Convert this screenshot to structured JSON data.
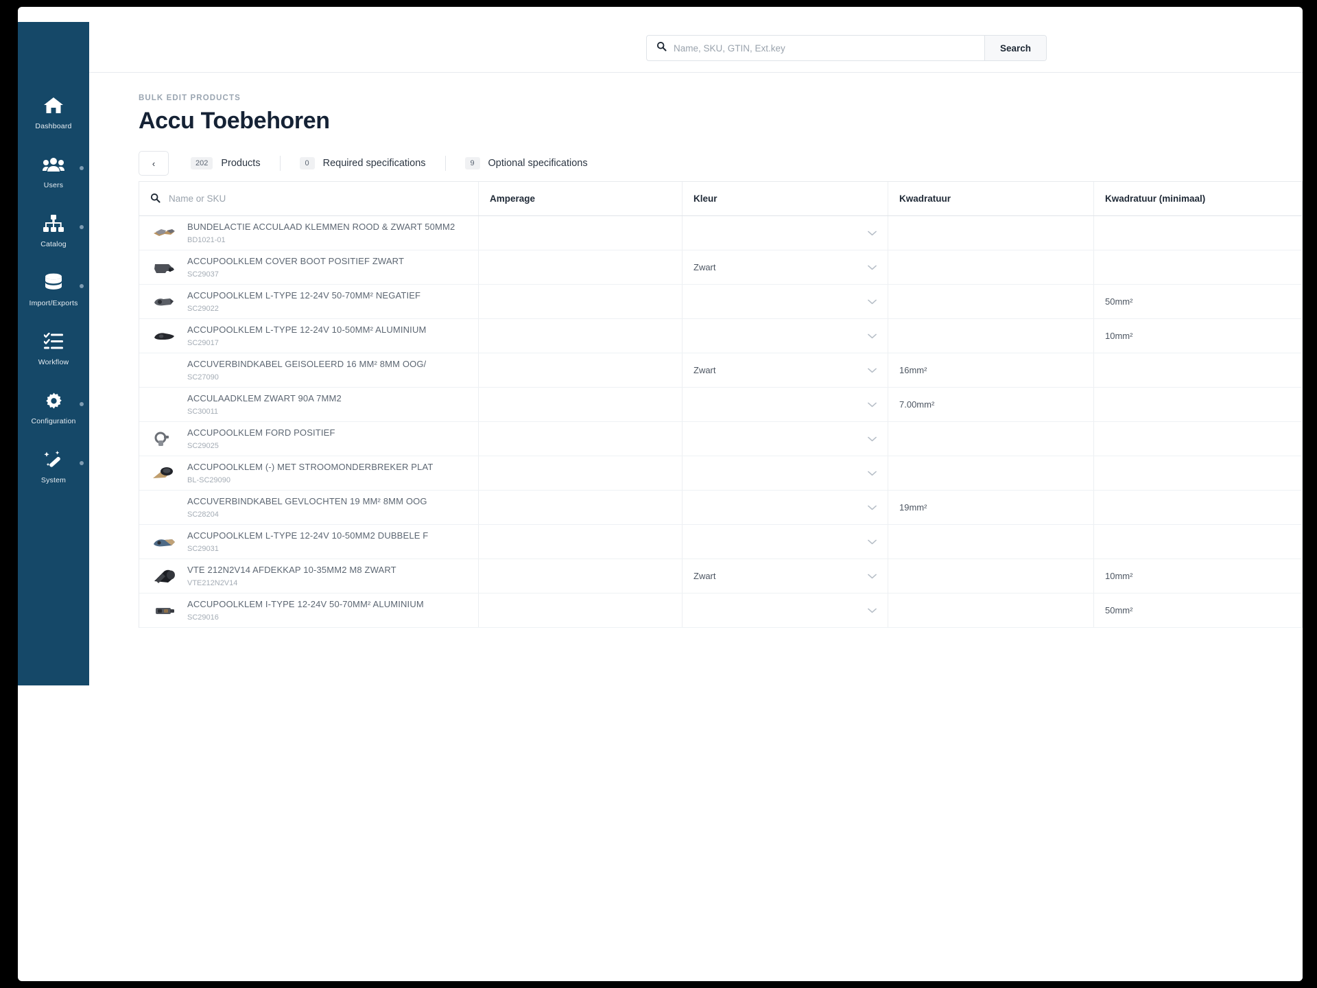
{
  "topbar": {
    "search_placeholder": "Name, SKU, GTIN, Ext.key",
    "search_value": "",
    "search_button": "Search",
    "search_icon": "search-icon"
  },
  "sidebar": {
    "items": [
      {
        "label": "Dashboard",
        "icon": "home-icon",
        "has_submenu": false
      },
      {
        "label": "Users",
        "icon": "users-icon",
        "has_submenu": true
      },
      {
        "label": "Catalog",
        "icon": "sitemap-icon",
        "has_submenu": true
      },
      {
        "label": "Import/Exports",
        "icon": "database-icon",
        "has_submenu": true
      },
      {
        "label": "Workflow",
        "icon": "tasklist-icon",
        "has_submenu": false
      },
      {
        "label": "Configuration",
        "icon": "gear-icon",
        "has_submenu": true
      },
      {
        "label": "System",
        "icon": "wand-icon",
        "has_submenu": true
      }
    ]
  },
  "page": {
    "breadcrumb": "BULK EDIT PRODUCTS",
    "title": "Accu Toebehoren",
    "back_label": "‹"
  },
  "tabs": [
    {
      "count": "202",
      "label": "Products"
    },
    {
      "count": "0",
      "label": "Required specifications"
    },
    {
      "count": "9",
      "label": "Optional specifications"
    }
  ],
  "table": {
    "name_filter_placeholder": "Name or SKU",
    "name_filter_value": "",
    "columns": [
      "Amperage",
      "Kleur",
      "Kwadratuur",
      "Kwadratuur (minimaal)"
    ],
    "rows": [
      {
        "name": "BUNDELACTIE ACCULAAD KLEMMEN ROOD & ZWART 50MM2",
        "sku": "BD1021-01",
        "thumb": "clamp-pair-thumb",
        "amperage": "",
        "kleur": "",
        "kwadratuur": "",
        "kwadratuur_min": ""
      },
      {
        "name": "ACCUPOOLKLEM COVER BOOT POSITIEF ZWART",
        "sku": "SC29037",
        "thumb": "cover-boot-thumb",
        "amperage": "",
        "kleur": "Zwart",
        "kwadratuur": "",
        "kwadratuur_min": ""
      },
      {
        "name": "ACCUPOOLKLEM L-TYPE 12-24V 50-70MM² NEGATIEF",
        "sku": "SC29022",
        "thumb": "l-clamp-thumb",
        "amperage": "",
        "kleur": "",
        "kwadratuur": "",
        "kwadratuur_min": "50mm²"
      },
      {
        "name": "ACCUPOOLKLEM L-TYPE 12-24V 10-50MM² ALUMINIUM",
        "sku": "SC29017",
        "thumb": "l-clamp-dark-thumb",
        "amperage": "",
        "kleur": "",
        "kwadratuur": "",
        "kwadratuur_min": "10mm²"
      },
      {
        "name": "ACCUVERBINDKABEL GEISOLEERD 16 MM² 8MM OOG/",
        "sku": "SC27090",
        "thumb": "",
        "amperage": "",
        "kleur": "Zwart",
        "kwadratuur": "16mm²",
        "kwadratuur_min": ""
      },
      {
        "name": "ACCULAADKLEM ZWART 90A 7MM2",
        "sku": "SC30011",
        "thumb": "",
        "amperage": "",
        "kleur": "",
        "kwadratuur": "7.00mm²",
        "kwadratuur_min": ""
      },
      {
        "name": "ACCUPOOLKLEM FORD POSITIEF",
        "sku": "SC29025",
        "thumb": "ford-clamp-thumb",
        "amperage": "",
        "kleur": "",
        "kwadratuur": "",
        "kwadratuur_min": ""
      },
      {
        "name": "ACCUPOOLKLEM (-) MET STROOMONDERBREKER PLAT",
        "sku": "BL-SC29090",
        "thumb": "breaker-clamp-thumb",
        "amperage": "",
        "kleur": "",
        "kwadratuur": "",
        "kwadratuur_min": ""
      },
      {
        "name": "ACCUVERBINDKABEL GEVLOCHTEN 19 MM² 8MM OOG",
        "sku": "SC28204",
        "thumb": "",
        "amperage": "",
        "kleur": "",
        "kwadratuur": "19mm²",
        "kwadratuur_min": ""
      },
      {
        "name": "ACCUPOOLKLEM L-TYPE 12-24V 10-50MM2 DUBBELE F",
        "sku": "SC29031",
        "thumb": "l-clamp-double-thumb",
        "amperage": "",
        "kleur": "",
        "kwadratuur": "",
        "kwadratuur_min": ""
      },
      {
        "name": "VTE 212N2V14 AFDEKKAP 10-35MM2 M8 ZWART",
        "sku": "VTE212N2V14",
        "thumb": "cap-thumb",
        "amperage": "",
        "kleur": "Zwart",
        "kwadratuur": "",
        "kwadratuur_min": "10mm²"
      },
      {
        "name": "ACCUPOOLKLEM I-TYPE 12-24V 50-70MM² ALUMINIUM",
        "sku": "SC29016",
        "thumb": "i-clamp-thumb",
        "amperage": "",
        "kleur": "",
        "kwadratuur": "",
        "kwadratuur_min": "50mm²"
      }
    ]
  },
  "colors": {
    "sidebar_bg": "#154868",
    "title": "#152235",
    "muted": "#9aa5b1",
    "border": "#e7eaee"
  }
}
